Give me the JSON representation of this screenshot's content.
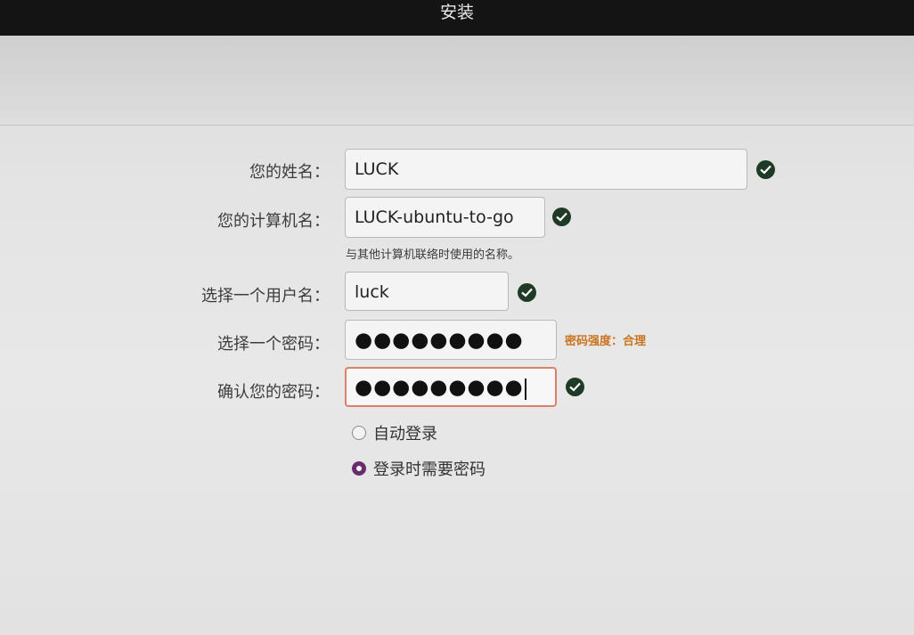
{
  "window": {
    "title": "安装"
  },
  "form": {
    "name": {
      "label": "您的姓名：",
      "value": "LUCK"
    },
    "computer_name": {
      "label": "您的计算机名：",
      "value": "LUCK-ubuntu-to-go",
      "hint": "与其他计算机联络时使用的名称。"
    },
    "username": {
      "label": "选择一个用户名：",
      "value": "luck"
    },
    "password": {
      "label": "选择一个密码：",
      "masked": "●●●●●●●●●",
      "strength": "密码强度：合理"
    },
    "confirm_password": {
      "label": "确认您的密码：",
      "masked": "●●●●●●●●●"
    }
  },
  "login_options": [
    {
      "label": "自动登录",
      "selected": false
    },
    {
      "label": "登录时需要密码",
      "selected": true
    }
  ],
  "colors": {
    "check": "#1f3a26",
    "strength": "#c9741d",
    "radio_accent": "#6a2d6b",
    "focus_border": "#d9826a"
  },
  "icons": {
    "valid": "check-circle-icon"
  }
}
